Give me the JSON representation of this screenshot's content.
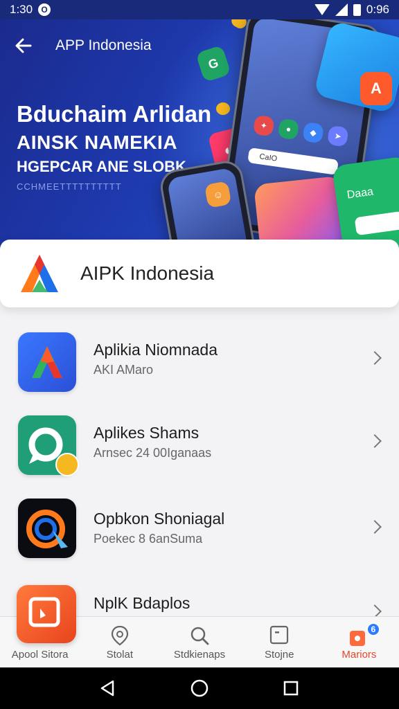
{
  "status_bar": {
    "time": "1:30",
    "notification_glyph": "O",
    "battery_text": "0:96"
  },
  "header": {
    "back_icon": "arrow-left-icon",
    "title": "APP Indonesia"
  },
  "hero": {
    "headline": "Bduchaim Arlidan",
    "subline1": "AINSK NAMEKIA",
    "subline2": "HGEPCAR ANE SLOBK",
    "tagline": "CCHMEETTTTTTTTTT",
    "mini_search_text": "CaIO",
    "card_label": "Daaa"
  },
  "app_card": {
    "name": "AIPK Indonesia"
  },
  "list": {
    "items": [
      {
        "title": "Aplikia Niomnada",
        "subtitle": "AKI AMaro",
        "icon": "a-logo-icon"
      },
      {
        "title": "Aplikes Shams",
        "subtitle": "Arnsec 24 00Iganaas",
        "icon": "chat-bubble-icon"
      },
      {
        "title": "Opbkon Shoniagal",
        "subtitle": "Poekec 8 6anSuma",
        "icon": "compass-pen-icon"
      },
      {
        "title": "NplK Bdaplos",
        "subtitle": "",
        "icon": "square-arrow-icon"
      }
    ]
  },
  "bottom_nav": {
    "tabs": [
      {
        "label": "Apool Sitora",
        "icon": "store-icon"
      },
      {
        "label": "Stolat",
        "icon": "location-pin-icon"
      },
      {
        "label": "Stdkienaps",
        "icon": "search-icon"
      },
      {
        "label": "Stojne",
        "icon": "square-icon"
      },
      {
        "label": "Mariors",
        "icon": "shopping-bag-icon",
        "badge": "6",
        "active": true
      }
    ]
  },
  "colors": {
    "accent": "#e8452c",
    "hero_bg": "#1e3bb0",
    "status_bar": "#1a2a7a"
  }
}
